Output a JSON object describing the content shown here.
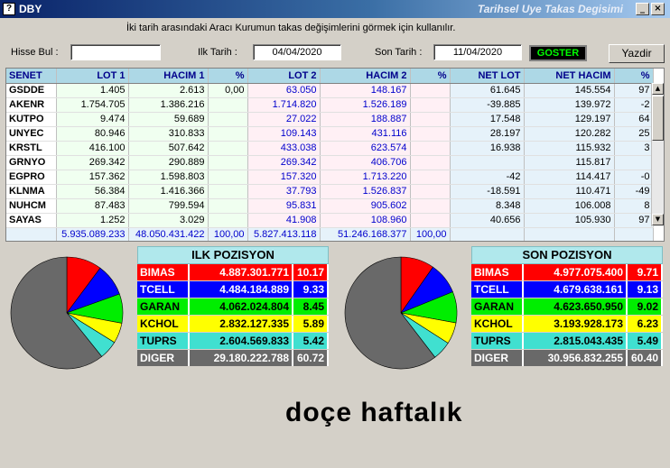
{
  "window": {
    "app_name": "DBY",
    "title": "Tarihsel Uye Takas Degisimi",
    "icon": "app-window-icon"
  },
  "description": "İki tarih arasındaki  Aracı Kurumun takas değişimlerini görmek için kullanılır.",
  "controls": {
    "hisse_label": "Hisse Bul :",
    "hisse_value": "",
    "ilk_label": "Ilk Tarih :",
    "ilk_value": "04/04/2020",
    "son_label": "Son Tarih :",
    "son_value": "11/04/2020",
    "goster_label": "GOSTER",
    "yazdir_label": "Yazdir"
  },
  "grid": {
    "headers": [
      "SENET",
      "LOT 1",
      "HACIM 1",
      "%",
      "LOT 2",
      "HACIM 2",
      "%",
      "NET LOT",
      "NET HACIM",
      "%"
    ],
    "rows": [
      [
        "GSDDE",
        "1.405",
        "2.613",
        "0,00",
        "63.050",
        "148.167",
        "",
        "61.645",
        "145.554",
        "97"
      ],
      [
        "AKENR",
        "1.754.705",
        "1.386.216",
        "",
        "1.714.820",
        "1.526.189",
        "",
        "-39.885",
        "139.972",
        "-2"
      ],
      [
        "KUTPO",
        "9.474",
        "59.689",
        "",
        "27.022",
        "188.887",
        "",
        "17.548",
        "129.197",
        "64"
      ],
      [
        "UNYEC",
        "80.946",
        "310.833",
        "",
        "109.143",
        "431.116",
        "",
        "28.197",
        "120.282",
        "25"
      ],
      [
        "KRSTL",
        "416.100",
        "507.642",
        "",
        "433.038",
        "623.574",
        "",
        "16.938",
        "115.932",
        "3"
      ],
      [
        "GRNYO",
        "269.342",
        "290.889",
        "",
        "269.342",
        "406.706",
        "",
        "",
        "115.817",
        ""
      ],
      [
        "EGPRO",
        "157.362",
        "1.598.803",
        "",
        "157.320",
        "1.713.220",
        "",
        "-42",
        "114.417",
        "-0"
      ],
      [
        "KLNMA",
        "56.384",
        "1.416.366",
        "",
        "37.793",
        "1.526.837",
        "",
        "-18.591",
        "110.471",
        "-49"
      ],
      [
        "NUHCM",
        "87.483",
        "799.594",
        "",
        "95.831",
        "905.602",
        "",
        "8.348",
        "106.008",
        "8"
      ],
      [
        "SAYAS",
        "1.252",
        "3.029",
        "",
        "41.908",
        "108.960",
        "",
        "40.656",
        "105.930",
        "97"
      ]
    ],
    "totals": [
      "",
      "5.935.089.233",
      "48.050.431.422",
      "100,00",
      "5.827.413.118",
      "51.246.168.377",
      "100,00",
      "",
      "",
      ""
    ]
  },
  "ilk_pozisyon": {
    "title": "ILK POZISYON",
    "rows": [
      {
        "name": "BIMAS",
        "value": "4.887.301.771",
        "pct": "10.17",
        "pct_num": 10.17,
        "color": "#ff0000"
      },
      {
        "name": "TCELL",
        "value": "4.484.184.889",
        "pct": "9.33",
        "pct_num": 9.33,
        "color": "#0000ff"
      },
      {
        "name": "GARAN",
        "value": "4.062.024.804",
        "pct": "8.45",
        "pct_num": 8.45,
        "color": "#00ee00"
      },
      {
        "name": "KCHOL",
        "value": "2.832.127.335",
        "pct": "5.89",
        "pct_num": 5.89,
        "color": "#ffff00"
      },
      {
        "name": "TUPRS",
        "value": "2.604.569.833",
        "pct": "5.42",
        "pct_num": 5.42,
        "color": "#40e0d0"
      },
      {
        "name": "DIGER",
        "value": "29.180.222.788",
        "pct": "60.72",
        "pct_num": 60.72,
        "color": "#696969"
      }
    ]
  },
  "son_pozisyon": {
    "title": "SON POZISYON",
    "rows": [
      {
        "name": "BIMAS",
        "value": "4.977.075.400",
        "pct": "9.71",
        "pct_num": 9.71,
        "color": "#ff0000"
      },
      {
        "name": "TCELL",
        "value": "4.679.638.161",
        "pct": "9.13",
        "pct_num": 9.13,
        "color": "#0000ff"
      },
      {
        "name": "GARAN",
        "value": "4.623.650.950",
        "pct": "9.02",
        "pct_num": 9.02,
        "color": "#00ee00"
      },
      {
        "name": "KCHOL",
        "value": "3.193.928.173",
        "pct": "6.23",
        "pct_num": 6.23,
        "color": "#ffff00"
      },
      {
        "name": "TUPRS",
        "value": "2.815.043.435",
        "pct": "5.49",
        "pct_num": 5.49,
        "color": "#40e0d0"
      },
      {
        "name": "DIGER",
        "value": "30.956.832.255",
        "pct": "60.40",
        "pct_num": 60.4,
        "color": "#696969"
      }
    ]
  },
  "overlay_text": "doçe haftalık"
}
